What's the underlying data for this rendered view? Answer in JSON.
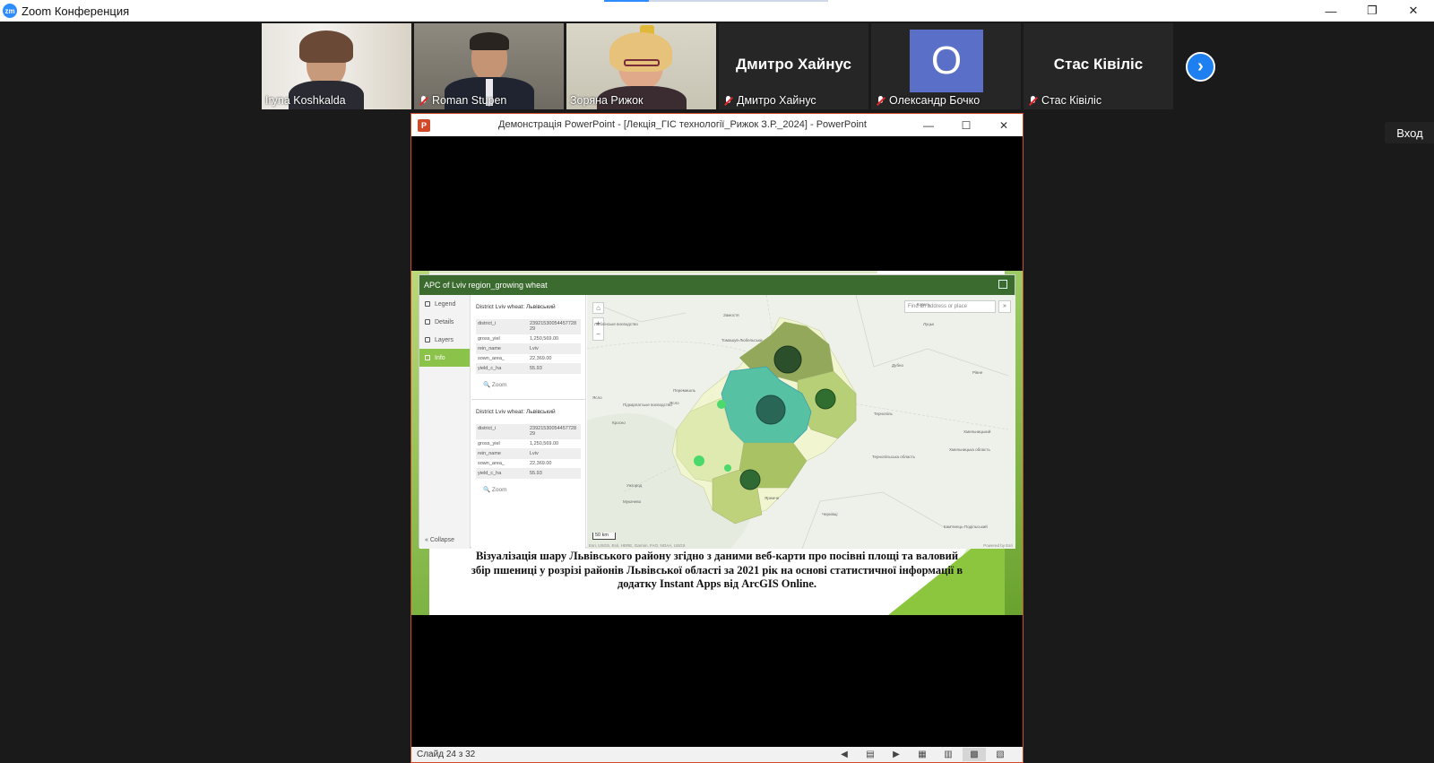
{
  "app": {
    "title": "Zoom Конференция",
    "logo": "zm"
  },
  "window_controls": {
    "minimize": "—",
    "restore": "❐",
    "close": "✕"
  },
  "participants": [
    {
      "name": "Iryna Koshkalda",
      "muted": false,
      "video": true
    },
    {
      "name": "Roman Stupen",
      "muted": true,
      "video": true
    },
    {
      "name": "Зоряна Рижок",
      "muted": false,
      "video": true,
      "active": true
    },
    {
      "name": "Дмитро Хайнус",
      "muted": true,
      "video": false,
      "display": "Дмитро Хайнус"
    },
    {
      "name": "Олександр Бочко",
      "muted": true,
      "video": false,
      "avatar_letter": "О"
    },
    {
      "name": "Стас Ківіліс",
      "muted": true,
      "video": false,
      "display": "Стас Ківіліс"
    }
  ],
  "next_page_icon": "chevron-right-icon",
  "exit_button": "Вход",
  "ppt": {
    "title": "Демонстрація PowerPoint - [Лекція_ГІС технології_Рижок З.Р._2024] - PowerPoint",
    "icon": "P",
    "status": "Слайд 24 з 32",
    "tools": [
      "◀",
      "▤",
      "▶",
      "▦",
      "▥",
      "▩",
      "▧",
      "▭"
    ]
  },
  "webapp": {
    "title": "APC of Lviv region_growing wheat",
    "nav": [
      {
        "label": "Legend",
        "icon": "legend-icon"
      },
      {
        "label": "Details",
        "icon": "details-icon"
      },
      {
        "label": "Layers",
        "icon": "layers-icon"
      },
      {
        "label": "Info",
        "icon": "info-icon",
        "selected": true
      }
    ],
    "collapse": "«  Collapse",
    "cards": [
      {
        "title": "District Lviv wheat: Львівський",
        "rows": [
          {
            "k": "district_i",
            "v": "2392153005445772829"
          },
          {
            "k": "gross_yiel",
            "v": "1,250,569.00"
          },
          {
            "k": "rein_name",
            "v": "Lviv"
          },
          {
            "k": "sown_area_",
            "v": "22,369.00"
          },
          {
            "k": "yield_c_ha",
            "v": "55.93"
          }
        ],
        "zoom": "🔍  Zoom"
      },
      {
        "title": "District Lviv wheat: Львівський",
        "rows": [
          {
            "k": "district_i",
            "v": "2392153005445772829"
          },
          {
            "k": "gross_yiel",
            "v": "1,250,569.00"
          },
          {
            "k": "rein_name",
            "v": "Lviv"
          },
          {
            "k": "sown_area_",
            "v": "22,369.00"
          },
          {
            "k": "yield_c_ha",
            "v": "55.93"
          }
        ],
        "zoom": "🔍  Zoom"
      }
    ],
    "map": {
      "search_placeholder": "Find an address or place",
      "scale": "50 km",
      "attribution": "Esri, USGS, Esri, HERE, Garmin, FAO, NOAA, USGS",
      "powered": "Powered by Esri",
      "labels": [
        "Замостя",
        "Томашув-Любельськи",
        "Ковель",
        "Луцьк",
        "Дубно",
        "Рівне",
        "Перемишль",
        "Кросно",
        "Ясло",
        "Ужгород",
        "Мукачево",
        "Тернопіль",
        "Хмельницький",
        "Чернівці",
        "Яремче",
        "Тернопільська область",
        "Хмельницька область",
        "Кам'янець-Подільський",
        "Ясло",
        "Підкарпатське воєводство",
        "Люблінське воєводство"
      ]
    }
  },
  "slide_caption": "Візуалізація шару Львівського району згідно з даними веб-карти про посівні площі та валовий збір пшениці у розрізі районів Львівської області за 2021 рік на основі статистичної інформації в додатку Instant Apps від ArcGIS Online.",
  "colors": {
    "zoom_blue": "#2d8cff",
    "active_speaker": "#9cd34d",
    "ppt_red": "#d04a2a",
    "slide_green": "#8cc63f",
    "header_green": "#3b6b2f"
  }
}
